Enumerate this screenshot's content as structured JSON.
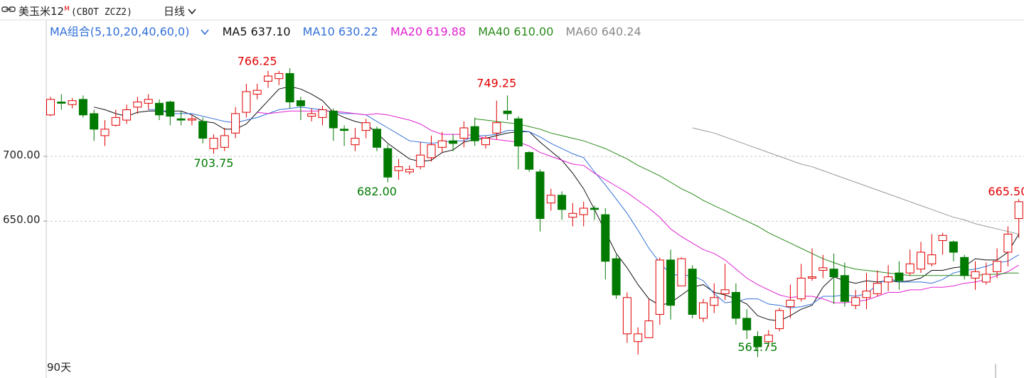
{
  "header": {
    "title": "美玉米12",
    "title_sup": "M",
    "code": "(CBOT ZCZ2)",
    "period": "日线"
  },
  "legend": {
    "combo": "MA组合(5,10,20,40,60,0)",
    "ma5": "MA5 637.10",
    "ma10": "MA10 630.22",
    "ma20": "MA20 619.88",
    "ma40": "MA40 610.00",
    "ma60": "MA60 640.24"
  },
  "footer": {
    "days": "90天"
  },
  "colors": {
    "up": "#e00000",
    "down": "#007a00",
    "ma5": "#111111",
    "ma10": "#3370d8",
    "ma20": "#e020d0",
    "ma40": "#2a8a1a",
    "ma60": "#999999"
  },
  "chart_data": {
    "type": "candlestick",
    "ylim": [
      530,
      790
    ],
    "y_ticks": [
      700,
      650
    ],
    "y_tick_labels": [
      "700.00",
      "650.00"
    ],
    "grid": "dashed horizontal at y ticks",
    "annotations": [
      {
        "label": "766.25",
        "index": 19,
        "value": 766.25,
        "kind": "high"
      },
      {
        "label": "749.25",
        "index": 41,
        "value": 749.25,
        "kind": "high"
      },
      {
        "label": "703.75",
        "index": 15,
        "value": 703.75,
        "kind": "low"
      },
      {
        "label": "682.00",
        "index": 30,
        "value": 682.0,
        "kind": "low"
      },
      {
        "label": "561.75",
        "index": 65,
        "value": 561.75,
        "kind": "low"
      },
      {
        "label": "665.50",
        "index": 88,
        "value": 665.5,
        "kind": "high"
      }
    ],
    "candles": [
      [
        732,
        744,
        746,
        731
      ],
      [
        742,
        741,
        748,
        736
      ],
      [
        740,
        743,
        745,
        737
      ],
      [
        744,
        732,
        747,
        730
      ],
      [
        733,
        721,
        736,
        712
      ],
      [
        716,
        721,
        728,
        708
      ],
      [
        724,
        730,
        736,
        723
      ],
      [
        728,
        736,
        740,
        725
      ],
      [
        738,
        742,
        746,
        733
      ],
      [
        741,
        744,
        748,
        736
      ],
      [
        741,
        732,
        744,
        728
      ],
      [
        742,
        731,
        743,
        724
      ],
      [
        729,
        728,
        735,
        724
      ],
      [
        728,
        729,
        732,
        724
      ],
      [
        727,
        714,
        730,
        710
      ],
      [
        706,
        714,
        717,
        702
      ],
      [
        707,
        716,
        722,
        704
      ],
      [
        718,
        733,
        738,
        714
      ],
      [
        734,
        750,
        756,
        730
      ],
      [
        748,
        751,
        756,
        744
      ],
      [
        758,
        762,
        766,
        753
      ],
      [
        760,
        764,
        766,
        755
      ],
      [
        764,
        742,
        768,
        737
      ],
      [
        743,
        739,
        746,
        728
      ],
      [
        731,
        733,
        737,
        727
      ],
      [
        730,
        736,
        739,
        724
      ],
      [
        735,
        722,
        737,
        712
      ],
      [
        721,
        720,
        724,
        708
      ],
      [
        709,
        714,
        722,
        704
      ],
      [
        720,
        726,
        729,
        714
      ],
      [
        721,
        707,
        723,
        704
      ],
      [
        706,
        684,
        709,
        680
      ],
      [
        689,
        692,
        698,
        682
      ],
      [
        688,
        690,
        693,
        686
      ],
      [
        692,
        701,
        711,
        690
      ],
      [
        699,
        709,
        716,
        696
      ],
      [
        707,
        712,
        719,
        703
      ],
      [
        712,
        710,
        717,
        704
      ],
      [
        714,
        722,
        727,
        707
      ],
      [
        723,
        712,
        730,
        708
      ],
      [
        709,
        714,
        716,
        706
      ],
      [
        718,
        726,
        743,
        713
      ],
      [
        735,
        733,
        747,
        728
      ],
      [
        729,
        708,
        731,
        690
      ],
      [
        703,
        690,
        704,
        688
      ],
      [
        688,
        652,
        690,
        642
      ],
      [
        664,
        670,
        675,
        658
      ],
      [
        670,
        659,
        673,
        651
      ],
      [
        653,
        656,
        664,
        646
      ],
      [
        655,
        660,
        665,
        646
      ],
      [
        660,
        659,
        662,
        651
      ],
      [
        655,
        619,
        660,
        605
      ],
      [
        621,
        593,
        624,
        590
      ],
      [
        563,
        591,
        595,
        556
      ],
      [
        557,
        563,
        568,
        547
      ],
      [
        560,
        573,
        590,
        565
      ],
      [
        578,
        620,
        622,
        570
      ],
      [
        620,
        585,
        628,
        574
      ],
      [
        600,
        621,
        622,
        601
      ],
      [
        613,
        578,
        616,
        575
      ],
      [
        575,
        587,
        590,
        572
      ],
      [
        585,
        591,
        602,
        579
      ],
      [
        594,
        597,
        617,
        589
      ],
      [
        595,
        575,
        602,
        570
      ],
      [
        575,
        566,
        582,
        559
      ],
      [
        561,
        553,
        565,
        545
      ],
      [
        557,
        562,
        566,
        553
      ],
      [
        567,
        581,
        583,
        565
      ],
      [
        584,
        589,
        601,
        575
      ],
      [
        590,
        606,
        617,
        588
      ],
      [
        606,
        607,
        629,
        604
      ],
      [
        612,
        614,
        624,
        606
      ],
      [
        613,
        607,
        625,
        586
      ],
      [
        608,
        588,
        618,
        584
      ],
      [
        585,
        591,
        597,
        582
      ],
      [
        591,
        596,
        610,
        582
      ],
      [
        594,
        602,
        612,
        592
      ],
      [
        603,
        607,
        616,
        596
      ],
      [
        610,
        604,
        619,
        597
      ],
      [
        610,
        617,
        628,
        608
      ],
      [
        613,
        626,
        634,
        610
      ],
      [
        617,
        624,
        640,
        615
      ],
      [
        635,
        639,
        641,
        624
      ],
      [
        634,
        626,
        635,
        619
      ],
      [
        622,
        608,
        624,
        605
      ],
      [
        606,
        611,
        619,
        597
      ],
      [
        603,
        609,
        618,
        601
      ],
      [
        611,
        619,
        629,
        606
      ],
      [
        626,
        640,
        646,
        615
      ],
      [
        652,
        665,
        667,
        637
      ],
      [
        660,
        663,
        666,
        652
      ]
    ],
    "series": [
      {
        "name": "MA5",
        "values": [
          null,
          null,
          null,
          null,
          738,
          736,
          733,
          731,
          734,
          735,
          735,
          735,
          735,
          732,
          727,
          726,
          721,
          721,
          725,
          734,
          743,
          752,
          754,
          752,
          748,
          743,
          734,
          730,
          727,
          725,
          718,
          710,
          704,
          698,
          696,
          697,
          703,
          705,
          711,
          713,
          714,
          716,
          718,
          719,
          719,
          711,
          704,
          697,
          687,
          675,
          659,
          642,
          625,
          614,
          601,
          590,
          585,
          587,
          593,
          599,
          601,
          595,
          593,
          590,
          586,
          577,
          574,
          573,
          577,
          582,
          585,
          599,
          607,
          604,
          602,
          604,
          603,
          604,
          603,
          604,
          606,
          612,
          612,
          614,
          615,
          621,
          620,
          620,
          626,
          640
        ]
      },
      {
        "name": "MA10",
        "values": [
          null,
          null,
          null,
          null,
          null,
          null,
          null,
          null,
          null,
          736,
          736,
          733,
          733,
          733,
          731,
          729,
          727,
          726,
          728,
          730,
          733,
          736,
          737,
          738,
          737,
          736,
          734,
          733,
          733,
          732,
          727,
          722,
          717,
          712,
          711,
          710,
          711,
          712,
          712,
          716,
          716,
          717,
          720,
          720,
          719,
          715,
          710,
          706,
          702,
          699,
          688,
          678,
          667,
          656,
          643,
          629,
          618,
          609,
          608,
          608,
          604,
          594,
          587,
          588,
          590,
          590,
          586,
          585,
          583,
          584,
          586,
          592,
          592,
          593,
          592,
          594,
          601,
          606,
          603,
          603,
          603,
          602,
          605,
          610,
          612,
          613,
          615,
          618,
          619,
          624
        ]
      },
      {
        "name": "MA20",
        "values": [
          null,
          null,
          null,
          null,
          null,
          null,
          null,
          null,
          null,
          null,
          null,
          null,
          null,
          null,
          null,
          null,
          null,
          null,
          null,
          734,
          733,
          734,
          735,
          735,
          735,
          735,
          735,
          734,
          733,
          732,
          733,
          732,
          730,
          728,
          725,
          720,
          717,
          717,
          717,
          716,
          714,
          713,
          712,
          711,
          708,
          703,
          700,
          697,
          694,
          693,
          687,
          682,
          677,
          672,
          666,
          660,
          653,
          644,
          638,
          633,
          628,
          625,
          620,
          613,
          606,
          601,
          597,
          593,
          591,
          592,
          592,
          590,
          587,
          587,
          588,
          589,
          592,
          595,
          595,
          597,
          597,
          599,
          599,
          600,
          602,
          603,
          605,
          608,
          611,
          616
        ]
      },
      {
        "name": "MA40",
        "values": [
          null,
          null,
          null,
          null,
          null,
          null,
          null,
          null,
          null,
          null,
          null,
          null,
          null,
          null,
          null,
          null,
          null,
          null,
          null,
          null,
          null,
          null,
          null,
          null,
          null,
          null,
          null,
          null,
          null,
          null,
          null,
          null,
          null,
          null,
          null,
          null,
          null,
          null,
          null,
          729,
          728,
          727,
          726,
          725,
          723,
          721,
          718,
          716,
          714,
          712,
          709,
          706,
          702,
          698,
          693,
          689,
          685,
          680,
          675,
          671,
          666,
          662,
          658,
          654,
          650,
          646,
          641,
          637,
          633,
          629,
          625,
          621,
          618,
          615,
          613,
          612,
          611,
          610,
          609,
          608,
          608,
          608,
          608,
          608,
          608,
          608,
          609,
          609,
          610,
          610
        ]
      },
      {
        "name": "MA60",
        "values": [
          null,
          null,
          null,
          null,
          null,
          null,
          null,
          null,
          null,
          null,
          null,
          null,
          null,
          null,
          null,
          null,
          null,
          null,
          null,
          null,
          null,
          null,
          null,
          null,
          null,
          null,
          null,
          null,
          null,
          null,
          null,
          null,
          null,
          null,
          null,
          null,
          null,
          null,
          null,
          null,
          null,
          null,
          null,
          null,
          null,
          null,
          null,
          null,
          null,
          null,
          null,
          null,
          null,
          null,
          null,
          null,
          null,
          null,
          null,
          722,
          720,
          718,
          715,
          712,
          709,
          706,
          703,
          700,
          697,
          694,
          692,
          689,
          686,
          683,
          680,
          677,
          674,
          671,
          668,
          665,
          662,
          659,
          656,
          653,
          651,
          648,
          646,
          644,
          642,
          640
        ]
      }
    ]
  }
}
